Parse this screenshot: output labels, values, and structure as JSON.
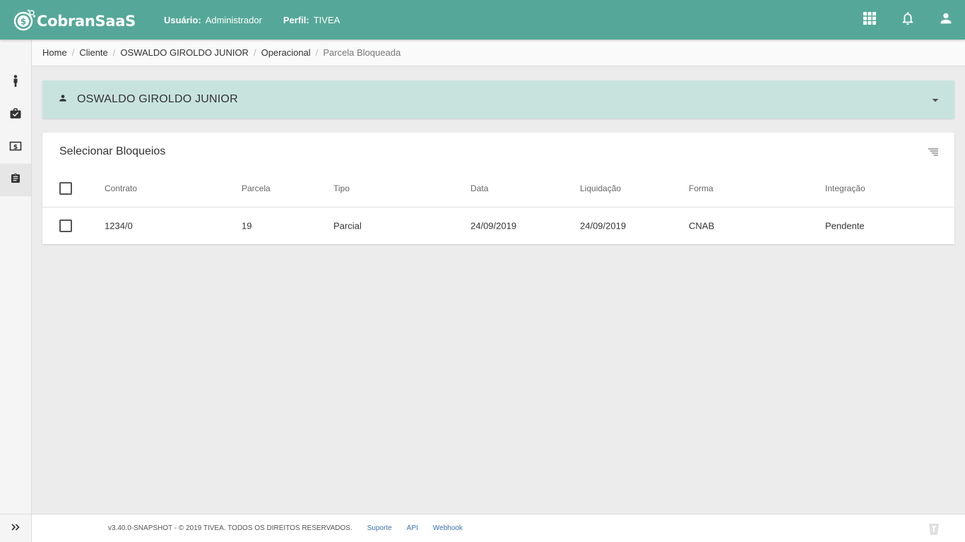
{
  "app": {
    "brand": "CobranSaaS"
  },
  "header": {
    "user_label": "Usuário:",
    "user_value": "Administrador",
    "profile_label": "Perfil:",
    "profile_value": "TIVEA"
  },
  "icons": {
    "apps": "grid-icon",
    "notifications": "bell-icon",
    "account": "person-icon",
    "sidebar": [
      "person-standing-icon",
      "briefcase-check-icon",
      "money-bill-icon",
      "clipboard-icon"
    ],
    "expand": "double-chevron-right-icon",
    "client": "person-icon",
    "toggle": "caret-down-icon",
    "filter": "filter-lines-icon"
  },
  "breadcrumb": [
    "Home",
    "Cliente",
    "OSWALDO GIROLDO JUNIOR",
    "Operacional",
    "Parcela Bloqueada"
  ],
  "client": {
    "name": "OSWALDO GIROLDO JUNIOR"
  },
  "card": {
    "title": "Selecionar Bloqueios",
    "columns": [
      "Contrato",
      "Parcela",
      "Tipo",
      "Data",
      "Liquidação",
      "Forma",
      "Integração"
    ],
    "rows": [
      [
        "1234/0",
        "19",
        "Parcial",
        "24/09/2019",
        "24/09/2019",
        "CNAB",
        "Pendente"
      ]
    ]
  },
  "footer": {
    "copyright": "v3.40.0-SNAPSHOT - © 2019 TIVEA. TODOS OS DIREITOS RESERVADOS.",
    "links": [
      "Suporte",
      "API",
      "Webhook"
    ]
  },
  "colors": {
    "primary": "#55a899",
    "client_panel": "#c8e3de",
    "link": "#3f6fb5",
    "background": "#ececec"
  }
}
